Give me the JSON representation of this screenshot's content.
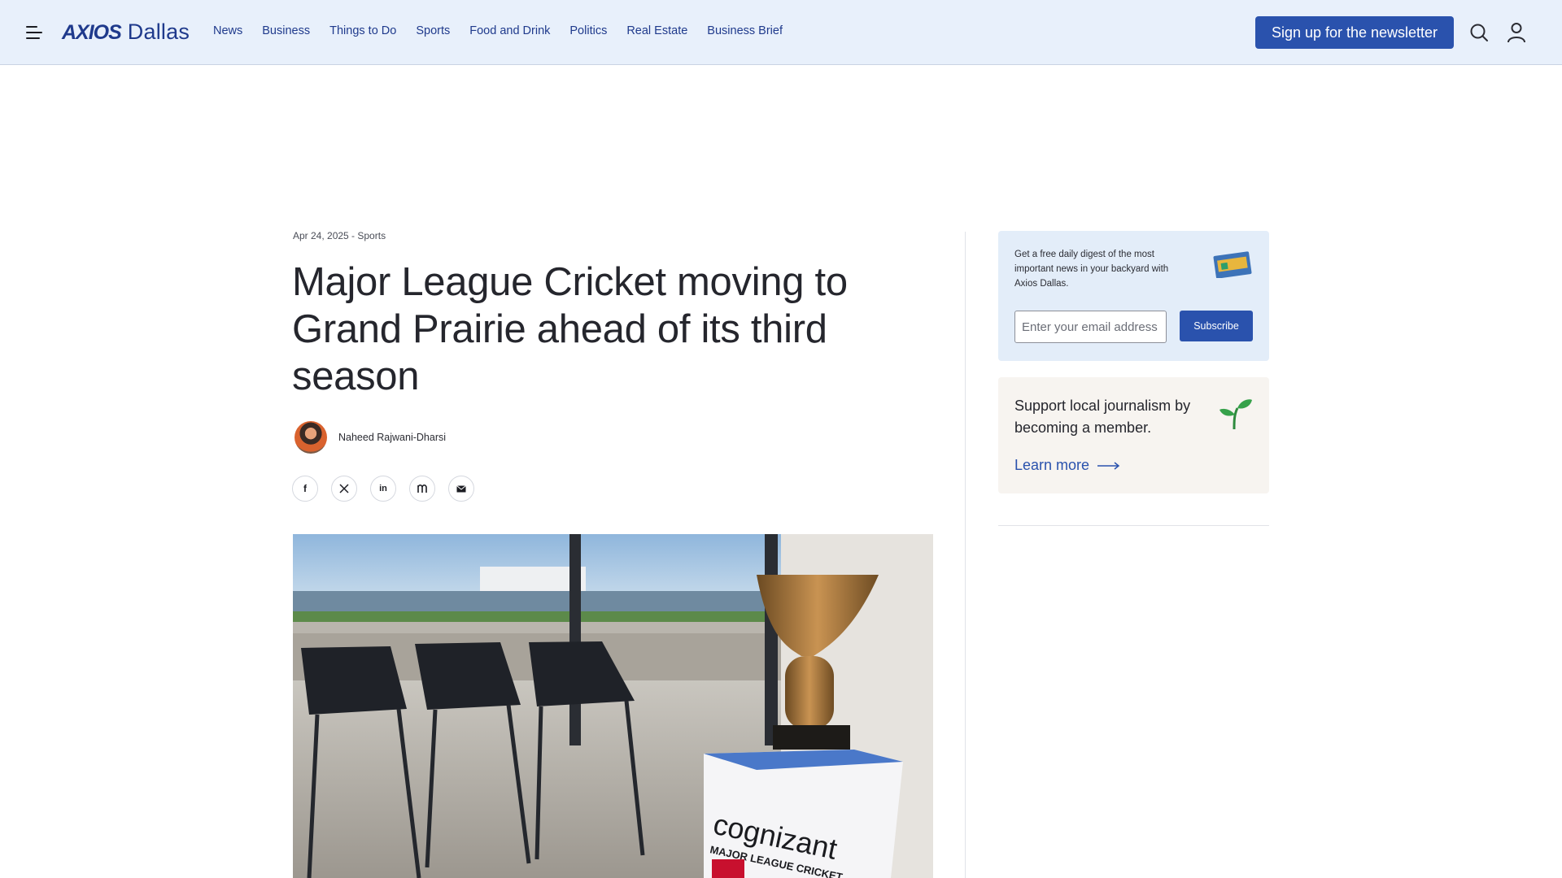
{
  "header": {
    "logo_brand": "AXIOS",
    "logo_city": "Dallas",
    "nav": [
      "News",
      "Business",
      "Things to Do",
      "Sports",
      "Food and Drink",
      "Politics",
      "Real Estate",
      "Business Brief"
    ],
    "signup_label": "Sign up for the newsletter",
    "icons": [
      "menu-icon",
      "search-icon",
      "user-icon"
    ]
  },
  "article": {
    "meta": "Apr 24, 2025 - Sports",
    "headline": "Major League Cricket moving to Grand Prairie ahead of its third season",
    "author": "Naheed Rajwani-Dharsi",
    "share_icons": [
      "facebook-icon",
      "x-icon",
      "linkedin-icon",
      "threads-icon",
      "email-icon"
    ],
    "hero_image_text_1": "cognizant",
    "hero_image_text_2": "MAJOR LEAGUE CRICKET"
  },
  "sidebar": {
    "newsletter_text": "Get a free daily digest of the most important news in your backyard with Axios Dallas.",
    "email_placeholder": "Enter your email address",
    "subscribe_label": "Subscribe",
    "member_text": "Support local journalism by becoming a member.",
    "learn_more_label": "Learn more"
  },
  "colors": {
    "header_bg": "#e8f0fb",
    "brand_blue": "#2a52ad",
    "logo_blue": "#1f3a8c",
    "newsletter_bg": "#e3edf9",
    "member_bg": "#f7f4f0"
  }
}
